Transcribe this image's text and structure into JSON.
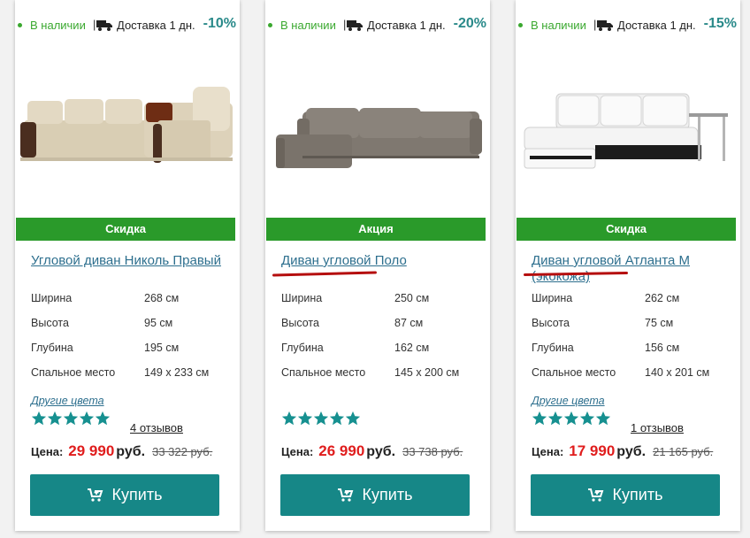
{
  "labels": {
    "in_stock": "В наличии",
    "delivery": "Доставка 1 дн.",
    "width": "Ширина",
    "height": "Высота",
    "depth": "Глубина",
    "sleeping": "Спальное место",
    "other_colors": "Другие цвета",
    "price": "Цена:",
    "currency": "руб.",
    "buy": "Купить"
  },
  "products": [
    {
      "discount": "-10%",
      "badge": "Скидка",
      "title": "Угловой диван Николь Правый",
      "width": "268 см",
      "height": "95 см",
      "depth": "195 см",
      "sleeping": "149 x 233 см",
      "other_colors": "Другие цвета",
      "rating": 5,
      "reviews": "4 отзывов",
      "price": "29 990",
      "old_price": "33 322 руб."
    },
    {
      "discount": "-20%",
      "badge": "Акция",
      "title": "Диван угловой Поло",
      "width": "250 см",
      "height": "87 см",
      "depth": "162 см",
      "sleeping": "145 x 200 см",
      "rating": 5,
      "price": "26 990",
      "old_price": "33 738 руб."
    },
    {
      "discount": "-15%",
      "badge": "Скидка",
      "title": "Диван угловой Атланта М (экокожа)",
      "width": "262 см",
      "height": "75 см",
      "depth": "156 см",
      "sleeping": "140 x 201 см",
      "other_colors": "Другие цвета",
      "rating": 5,
      "reviews": "1 отзывов",
      "price": "17 990",
      "old_price": "21 165 руб."
    }
  ],
  "colors": {
    "accent": "#168787",
    "badge": "#2a9a2a",
    "price": "#e01d1d",
    "link": "#2d6f8e",
    "star": "#169090",
    "in_stock": "#3aa82f",
    "annotation": "#b50e0e"
  }
}
